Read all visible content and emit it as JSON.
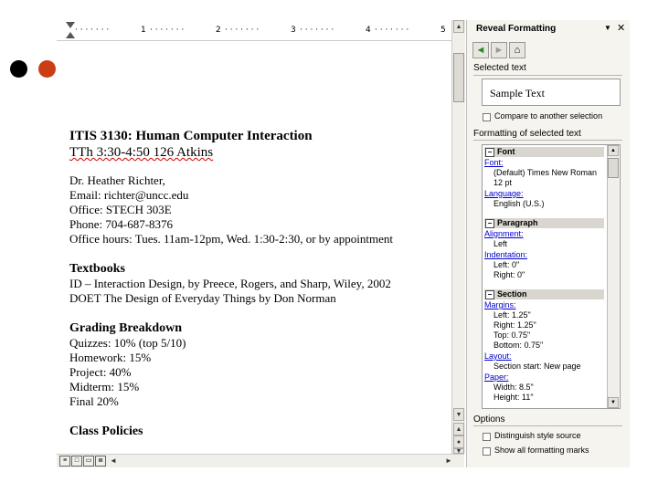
{
  "ruler": {
    "ticks": [
      "1",
      "2",
      "3",
      "4",
      "5"
    ]
  },
  "document": {
    "course_title": "ITIS 3130:  Human Computer Interaction",
    "schedule": "TTh 3:30-4:50  126 Atkins",
    "instructor": "Dr. Heather Richter,",
    "email": "Email: richter@uncc.edu",
    "office": "Office:  STECH 303E",
    "phone": "Phone:  704-687-8376",
    "office_hours": "Office hours:  Tues. 11am-12pm, Wed. 1:30-2:30, or by appointment",
    "textbooks_heading": "Textbooks",
    "textbook_1": "ID – Interaction Design, by Preece, Rogers, and Sharp, Wiley, 2002",
    "textbook_2": "DOET    The Design of Everyday Things by Don Norman",
    "grading_heading": "Grading Breakdown",
    "grading": [
      "Quizzes:  10%  (top 5/10)",
      "Homework: 15%",
      "Project:    40%",
      "Midterm: 15%",
      "Final       20%"
    ],
    "policies_heading": "Class Policies"
  },
  "pane": {
    "title": "Reveal Formatting",
    "menu_glyph": "▼",
    "close_glyph": "✕",
    "selected_text_label": "Selected text",
    "sample_text": "Sample Text",
    "compare_label": "Compare to another selection",
    "formatting_label": "Formatting of selected text",
    "sections": {
      "font": "Font",
      "paragraph": "Paragraph",
      "section": "Section"
    },
    "font_link": "Font:",
    "font_value": "(Default) Times New Roman",
    "font_size": "12 pt",
    "language_link": "Language:",
    "language_value": "English (U.S.)",
    "alignment_link": "Alignment:",
    "alignment_value": "Left",
    "indentation_link": "Indentation:",
    "indent_left": "Left:  0\"",
    "indent_right": "Right:  0\"",
    "margins_link": "Margins:",
    "margin_left": "Left:  1.25\"",
    "margin_right": "Right:  1.25\"",
    "margin_top": "Top:  0.75\"",
    "margin_bottom": "Bottom:  0.75\"",
    "layout_link": "Layout:",
    "layout_value": "Section start: New page",
    "paper_link": "Paper:",
    "paper_width": "Width:  8.5\"",
    "paper_height": "Height:  11\"",
    "options_label": "Options",
    "distinguish_label": "Distinguish style source",
    "show_marks_label": "Show all formatting marks"
  }
}
